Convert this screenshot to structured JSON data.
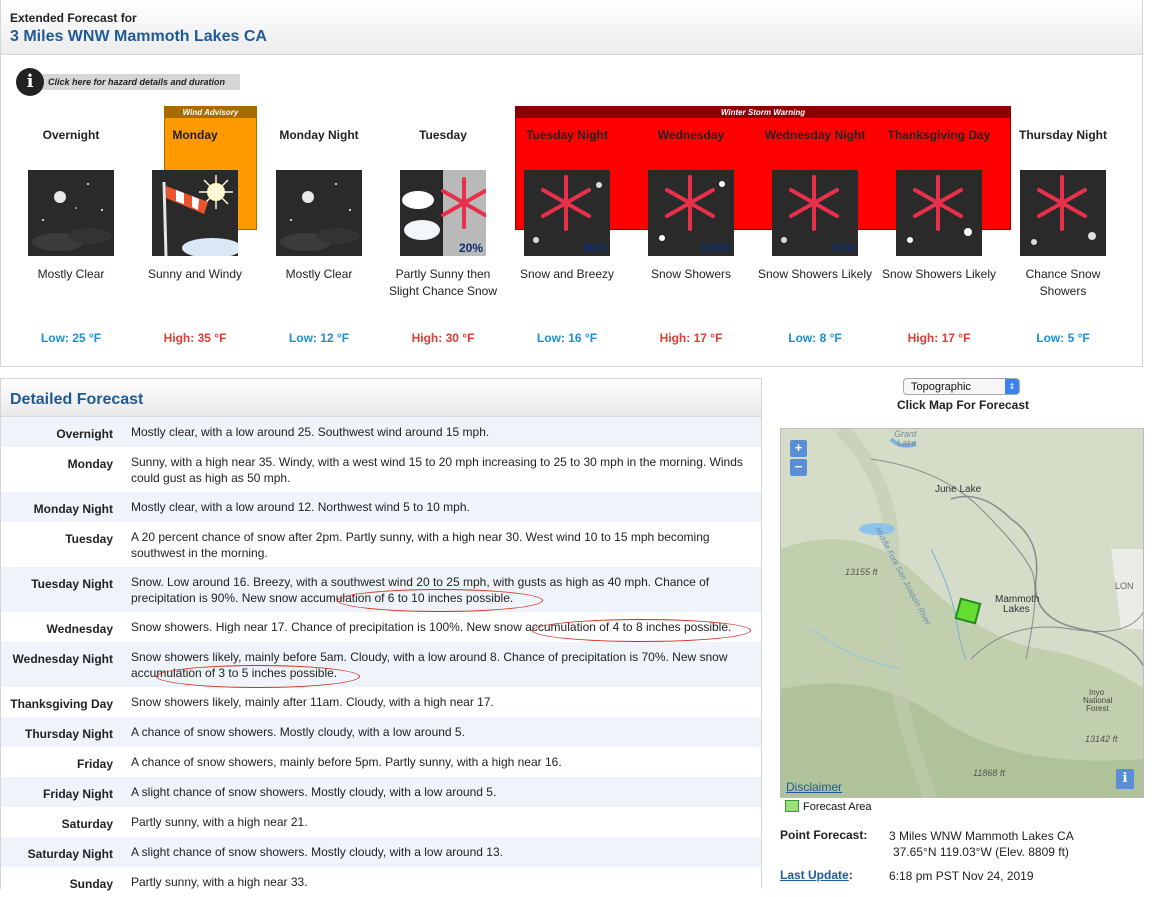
{
  "extended": {
    "header_small": "Extended Forecast for",
    "location": "3 Miles WNW Mammoth Lakes CA",
    "hazard_link": "Click here for hazard details and duration",
    "bands": {
      "wind_advisory": "Wind Advisory",
      "winter_storm": "Winter Storm Warning"
    },
    "periods": [
      {
        "name": "Overnight",
        "desc": "Mostly Clear",
        "temp": "Low: 25 °F",
        "pct": "",
        "icon": "night-moon-icon"
      },
      {
        "name": "Monday",
        "desc": "Sunny and Windy",
        "temp": "High: 35 °F",
        "pct": "",
        "icon": "windsock-sun-icon"
      },
      {
        "name": "Monday Night",
        "desc": "Mostly Clear",
        "temp": "Low: 12 °F",
        "pct": "",
        "icon": "night-moon-icon"
      },
      {
        "name": "Tuesday",
        "desc": "Partly Sunny then Slight Chance Snow",
        "temp": "High: 30 °F",
        "pct": "20%",
        "icon": "partly-sunny-snow-icon"
      },
      {
        "name": "Tuesday Night",
        "desc": "Snow and Breezy",
        "temp": "Low: 16 °F",
        "pct": "90%",
        "icon": "snowflake-icon"
      },
      {
        "name": "Wednesday",
        "desc": "Snow Showers",
        "temp": "High: 17 °F",
        "pct": "100%",
        "icon": "snowflake-icon"
      },
      {
        "name": "Wednesday Night",
        "desc": "Snow Showers Likely",
        "temp": "Low: 8 °F",
        "pct": "70%",
        "icon": "snowflake-icon"
      },
      {
        "name": "Thanksgiving Day",
        "desc": "Snow Showers Likely",
        "temp": "High: 17 °F",
        "pct": "",
        "icon": "snowflake-icon"
      },
      {
        "name": "Thursday Night",
        "desc": "Chance Snow Showers",
        "temp": "Low: 5 °F",
        "pct": "",
        "icon": "snowflake-icon"
      }
    ]
  },
  "detailed": {
    "title": "Detailed Forecast",
    "rows": [
      {
        "label": "Overnight",
        "text": "Mostly clear, with a low around 25. Southwest wind around 15 mph."
      },
      {
        "label": "Monday",
        "text": "Sunny, with a high near 35. Windy, with a west wind 15 to 20 mph increasing to 25 to 30 mph in the morning. Winds could gust as high as 50 mph."
      },
      {
        "label": "Monday Night",
        "text": "Mostly clear, with a low around 12. Northwest wind 5 to 10 mph."
      },
      {
        "label": "Tuesday",
        "text": "A 20 percent chance of snow after 2pm. Partly sunny, with a high near 30. West wind 10 to 15 mph becoming southwest in the morning."
      },
      {
        "label": "Tuesday Night",
        "text": "Snow. Low around 16. Breezy, with a southwest wind 20 to 25 mph, with gusts as high as 40 mph. Chance of precipitation is 90%. New snow accumulation of 6 to 10 inches possible."
      },
      {
        "label": "Wednesday",
        "text": "Snow showers. High near 17. Chance of precipitation is 100%. New snow accumulation of 4 to 8 inches possible."
      },
      {
        "label": "Wednesday Night",
        "text": "Snow showers likely, mainly before 5am. Cloudy, with a low around 8. Chance of precipitation is 70%. New snow accumulation of 3 to 5 inches possible."
      },
      {
        "label": "Thanksgiving Day",
        "text": "Snow showers likely, mainly after 11am. Cloudy, with a high near 17."
      },
      {
        "label": "Thursday Night",
        "text": "A chance of snow showers. Mostly cloudy, with a low around 5."
      },
      {
        "label": "Friday",
        "text": "A chance of snow showers, mainly before 5pm. Partly sunny, with a high near 16."
      },
      {
        "label": "Friday Night",
        "text": "A slight chance of snow showers. Mostly cloudy, with a low around 5."
      },
      {
        "label": "Saturday",
        "text": "Partly sunny, with a high near 21."
      },
      {
        "label": "Saturday Night",
        "text": "A slight chance of snow showers. Mostly cloudy, with a low around 13."
      },
      {
        "label": "Sunday",
        "text": "Partly sunny, with a high near 33."
      }
    ]
  },
  "map": {
    "select_value": "Topographic",
    "hint": "Click Map For Forecast",
    "labels": {
      "grant_lake": "Grant Lake",
      "june_lake": "June Lake",
      "river": "Middle Fork San Joaquin River",
      "elev1": "13155 ft",
      "elev2": "13142 ft",
      "elev3": "11868 ft",
      "mammoth": "Mammoth Lakes",
      "inyo": "Inyo National Forest",
      "lon": "LON"
    },
    "zoom_in": "+",
    "zoom_out": "−",
    "info": "i",
    "disclaimer": "Disclaimer",
    "legend": "Forecast Area"
  },
  "point": {
    "label": "Point Forecast:",
    "location": "3 Miles WNW Mammoth Lakes CA",
    "coords": "37.65°N 119.03°W (Elev. 8809 ft)",
    "update_label": "Last Update",
    "update_colon": ":",
    "update_value": "6:18 pm PST Nov 24, 2019"
  },
  "colors": {
    "low_temp": "#1a8fd6",
    "high_temp": "#e03c31",
    "wind_advisory": "#ff9900",
    "winter_storm": "#ff0000",
    "title_blue": "#1f5a99"
  }
}
